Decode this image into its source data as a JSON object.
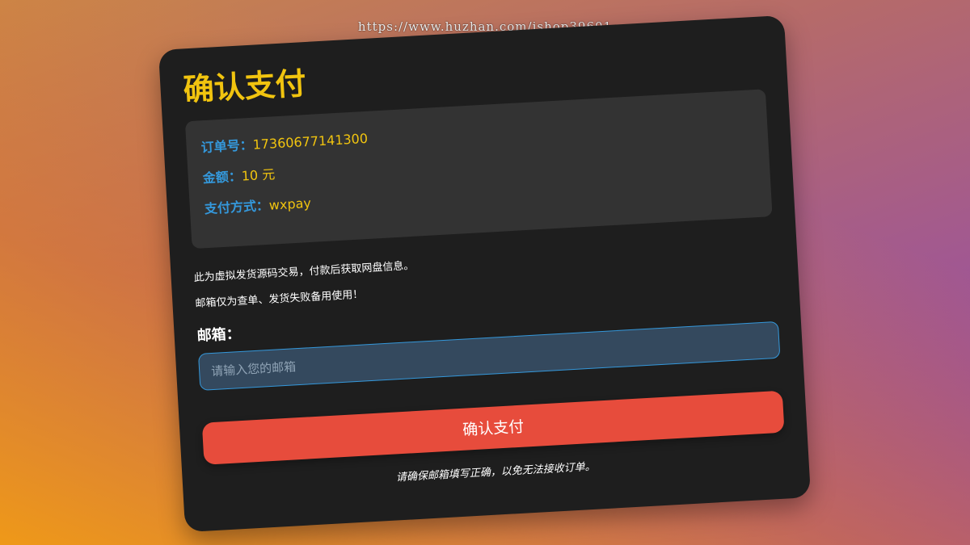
{
  "watermark": "https://www.huzhan.com/ishop39601",
  "page": {
    "title": "确认支付"
  },
  "order": {
    "number_label": "订单号：",
    "number_value": "17360677141300",
    "amount_label": "金额：",
    "amount_value": "10 元",
    "method_label": "支付方式：",
    "method_value": "wxpay"
  },
  "notices": {
    "line1": "此为虚拟发货源码交易，付款后获取网盘信息。",
    "line2": "邮箱仅为查单、发货失败备用使用！"
  },
  "email": {
    "label": "邮箱：",
    "placeholder": "请输入您的邮箱",
    "value": ""
  },
  "submit": {
    "label": "确认支付"
  },
  "footer": {
    "note": "请确保邮箱填写正确，以免无法接收订单。"
  },
  "colors": {
    "accent_yellow": "#f1c40f",
    "label_blue": "#3498db",
    "button_red": "#e74c3c",
    "card_bg": "#1e1e1e",
    "info_bg": "#333333",
    "input_bg": "#34495e"
  }
}
